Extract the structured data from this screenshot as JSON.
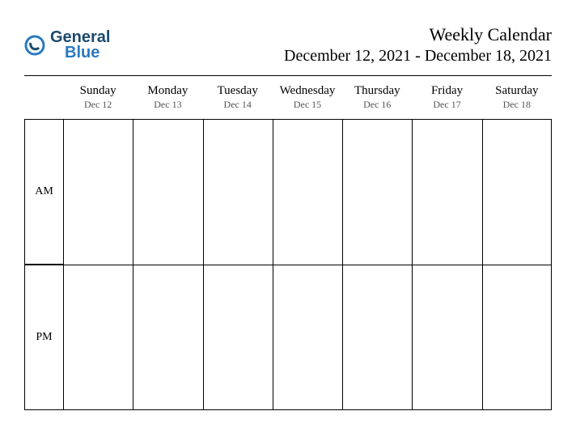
{
  "logo": {
    "word1": "General",
    "word2": "Blue"
  },
  "header": {
    "title": "Weekly Calendar",
    "range": "December 12, 2021 - December 18, 2021"
  },
  "days": [
    {
      "name": "Sunday",
      "date": "Dec 12"
    },
    {
      "name": "Monday",
      "date": "Dec 13"
    },
    {
      "name": "Tuesday",
      "date": "Dec 14"
    },
    {
      "name": "Wednesday",
      "date": "Dec 15"
    },
    {
      "name": "Thursday",
      "date": "Dec 16"
    },
    {
      "name": "Friday",
      "date": "Dec 17"
    },
    {
      "name": "Saturday",
      "date": "Dec 18"
    }
  ],
  "periods": {
    "am": "AM",
    "pm": "PM"
  }
}
